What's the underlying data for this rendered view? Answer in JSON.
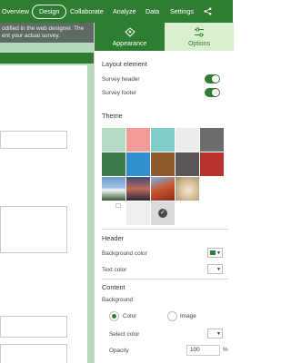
{
  "topnav": {
    "items": [
      "Overview",
      "Design",
      "Collaborate",
      "Analyze",
      "Data",
      "Settings"
    ],
    "active": "Design",
    "share_icon": "share-icon"
  },
  "left": {
    "banner_line1": "odified in the web designer. The",
    "banner_line2": "ent your actual survey."
  },
  "tabs": [
    {
      "label": "Appearance",
      "icon": "appearance-icon"
    },
    {
      "label": "Options",
      "icon": "sliders-icon"
    }
  ],
  "layout": {
    "title": "Layout element",
    "survey_header_label": "Survey header",
    "survey_footer_label": "Survey footer",
    "survey_header_on": true,
    "survey_footer_on": true
  },
  "theme": {
    "title": "Theme",
    "color_swatches": [
      "#b5dbc6",
      "#f29b98",
      "#7fcccb",
      "#ededed",
      "#6d6d6d",
      "#3f7a4a",
      "#2f8fcf",
      "#8f5a2e",
      "#5c5656",
      "#b8322e"
    ],
    "image_swatches": [
      "mountain-image",
      "mountain-sunset-image",
      "red-canyon-image",
      "sea-shell-image"
    ],
    "selected_swatch": "blank-theme-selected",
    "check_glyph": "✓"
  },
  "header": {
    "title": "Header",
    "background_color_label": "Background color",
    "text_color_label": "Text color",
    "background_color": "#2f7d32",
    "text_color": "#ffffff"
  },
  "content": {
    "title": "Content",
    "background_label": "Background",
    "option_color": "Color",
    "option_image": "Image",
    "selected_option": "Color",
    "select_color_label": "Select color",
    "opacity_label": "Opacity",
    "opacity_value": "100",
    "opacity_unit": "%"
  },
  "colors": {
    "brand_green": "#2f7d32",
    "options_tab_bg": "#d8f0cd",
    "canvas_bg": "#b6d9bc"
  }
}
